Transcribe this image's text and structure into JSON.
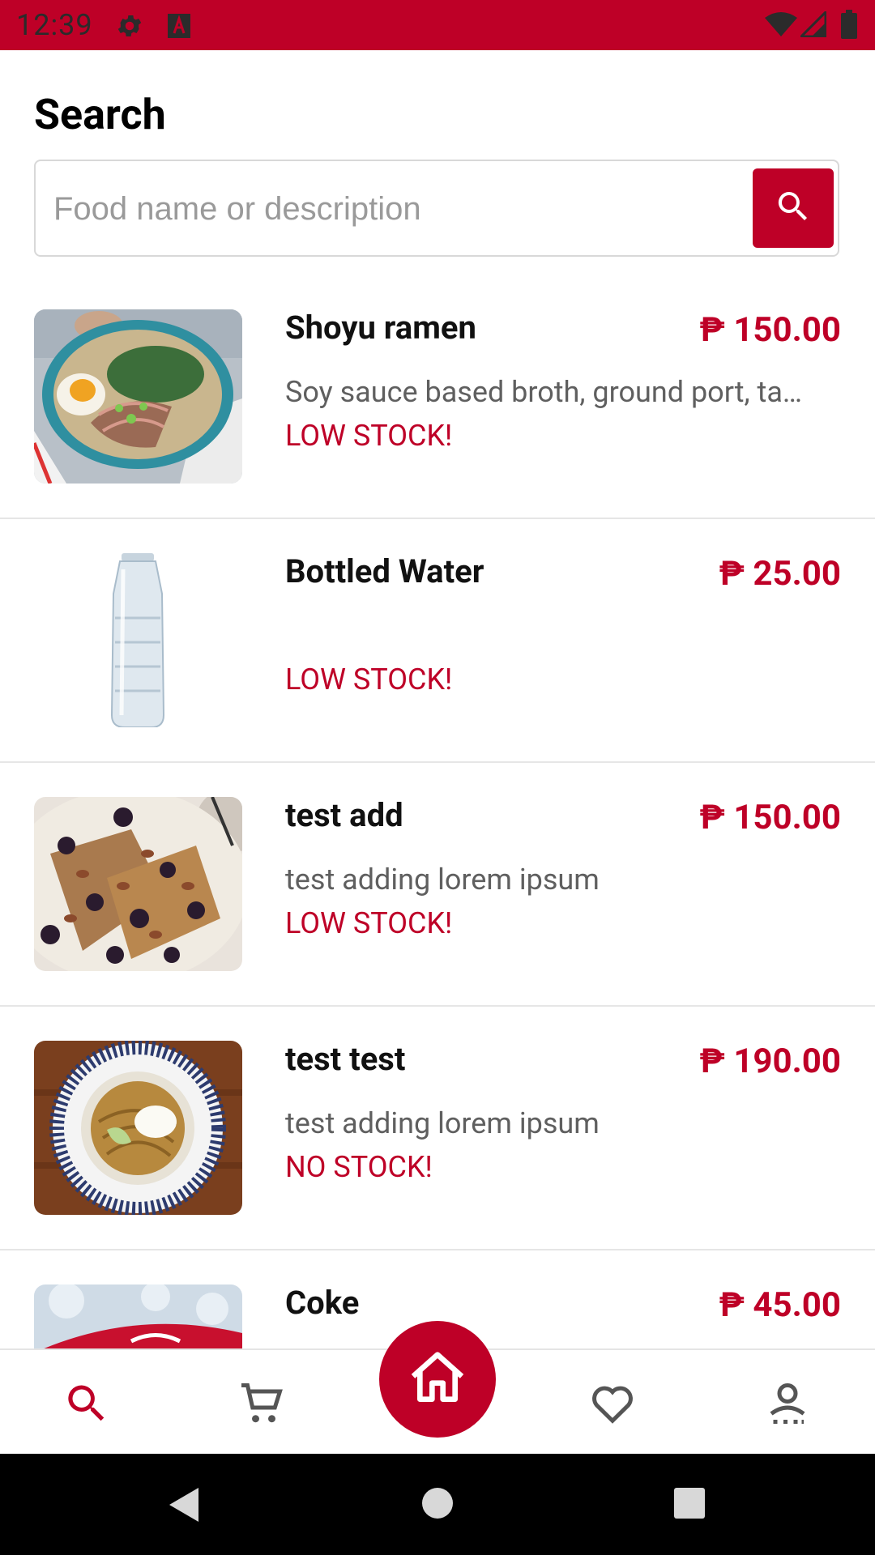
{
  "status_bar": {
    "time": "12:39",
    "left_icons": [
      "gear-icon",
      "app-notification-icon"
    ],
    "right_icons": [
      "wifi-icon",
      "signal-icon",
      "battery-icon"
    ]
  },
  "header": {
    "title": "Search"
  },
  "search": {
    "placeholder": "Food name or description",
    "value": "",
    "button_icon": "search-icon"
  },
  "colors": {
    "accent": "#be0027",
    "text": "#111111",
    "muted": "#5f5f5f"
  },
  "items": [
    {
      "name": "Shoyu ramen",
      "price": "₱ 150.00",
      "description": "Soy sauce based broth, ground port, ta…",
      "stock": "LOW STOCK!",
      "image": "ramen-bowl"
    },
    {
      "name": "Bottled Water",
      "price": "₱ 25.00",
      "description": "",
      "stock": "LOW STOCK!",
      "image": "water-bottle"
    },
    {
      "name": "test add",
      "price": "₱ 150.00",
      "description": "test adding lorem ipsum",
      "stock": "LOW STOCK!",
      "image": "french-toast-berries"
    },
    {
      "name": "test test",
      "price": "₱ 190.00",
      "description": "test adding lorem ipsum",
      "stock": "NO STOCK!",
      "image": "noodle-bowl"
    },
    {
      "name": "Coke",
      "price": "₱ 45.00",
      "description": "",
      "stock": "",
      "image": "coke-can"
    }
  ],
  "bottom_nav": {
    "items": [
      "search-icon",
      "cart-icon",
      "home-icon",
      "heart-icon",
      "profile-icon"
    ],
    "active": "search-icon"
  },
  "android_nav": [
    "back-button",
    "home-button",
    "recents-button"
  ]
}
